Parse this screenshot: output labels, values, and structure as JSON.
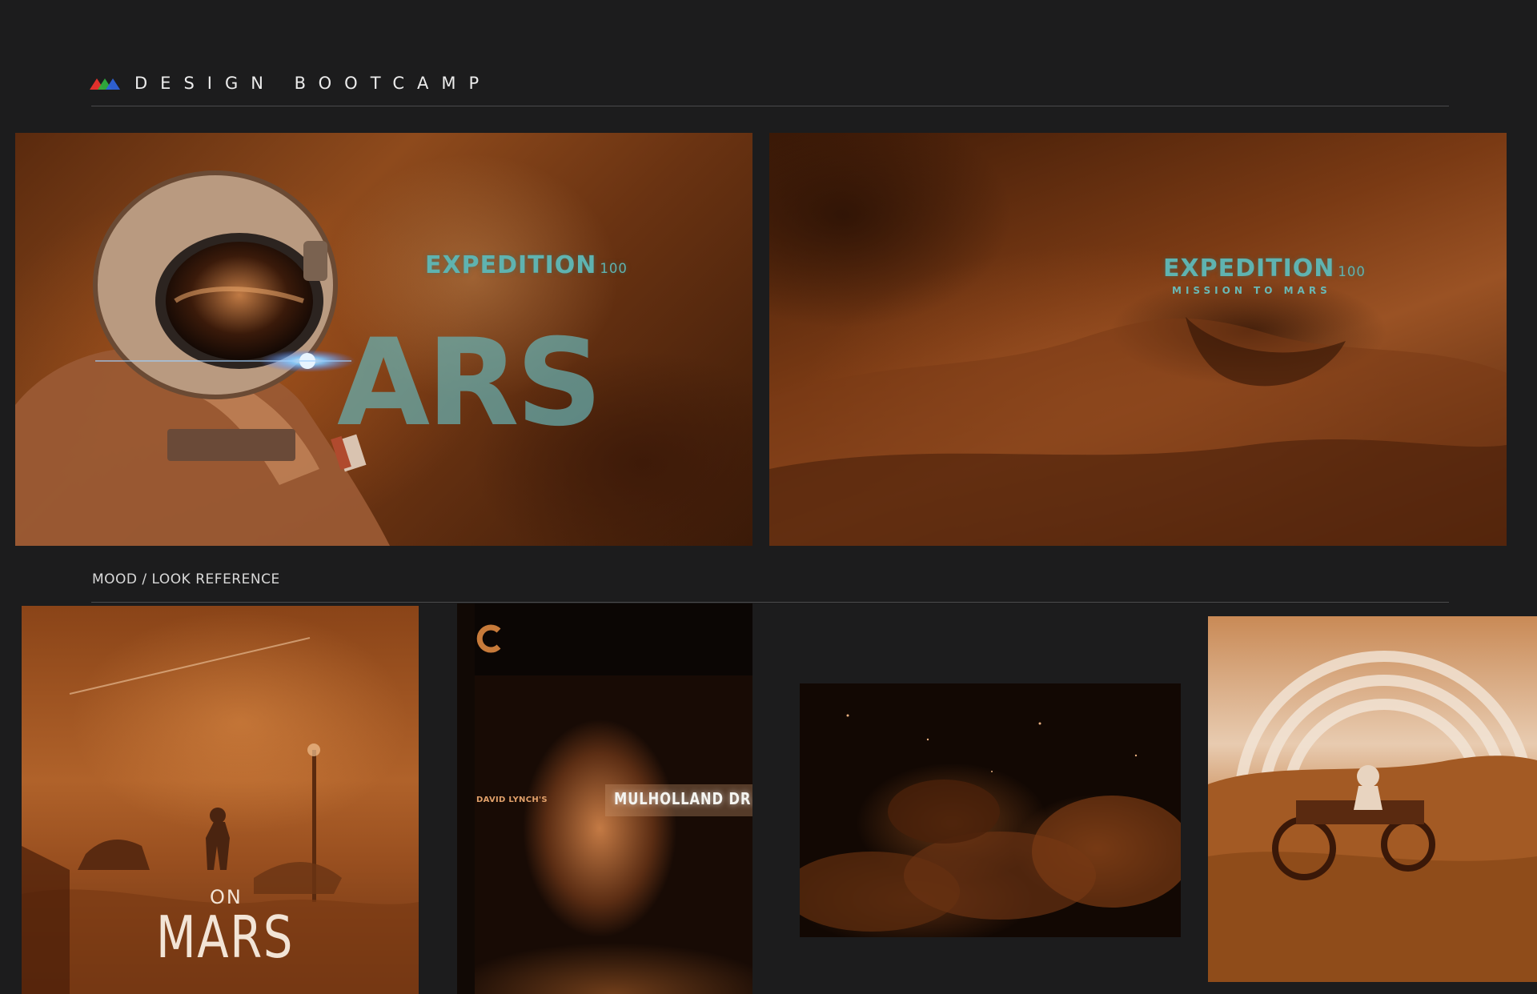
{
  "header": {
    "brand_name": "DESIGN BOOTCAMP",
    "logo_icon": "tricolor-mountains-icon",
    "logo_colors": [
      "#e0312c",
      "#2fae3c",
      "#2f63d8"
    ]
  },
  "hero_frames": [
    {
      "title": "EXPEDITION",
      "number": "100",
      "big_word": "ARS"
    },
    {
      "title": "EXPEDITION",
      "number": "100",
      "subtitle": "MISSION TO MARS"
    }
  ],
  "mood_section": {
    "label": "MOOD / LOOK REFERENCE"
  },
  "mood_images": [
    {
      "small_word": "ON",
      "big_word": "MARS"
    },
    {
      "director": "DAVID LYNCH'S",
      "title": "MULHOLLAND DR."
    },
    {},
    {}
  ],
  "colors": {
    "background": "#1c1c1d",
    "accent_teal": "#5fb3b0",
    "mars_orange": "#b0622a"
  }
}
